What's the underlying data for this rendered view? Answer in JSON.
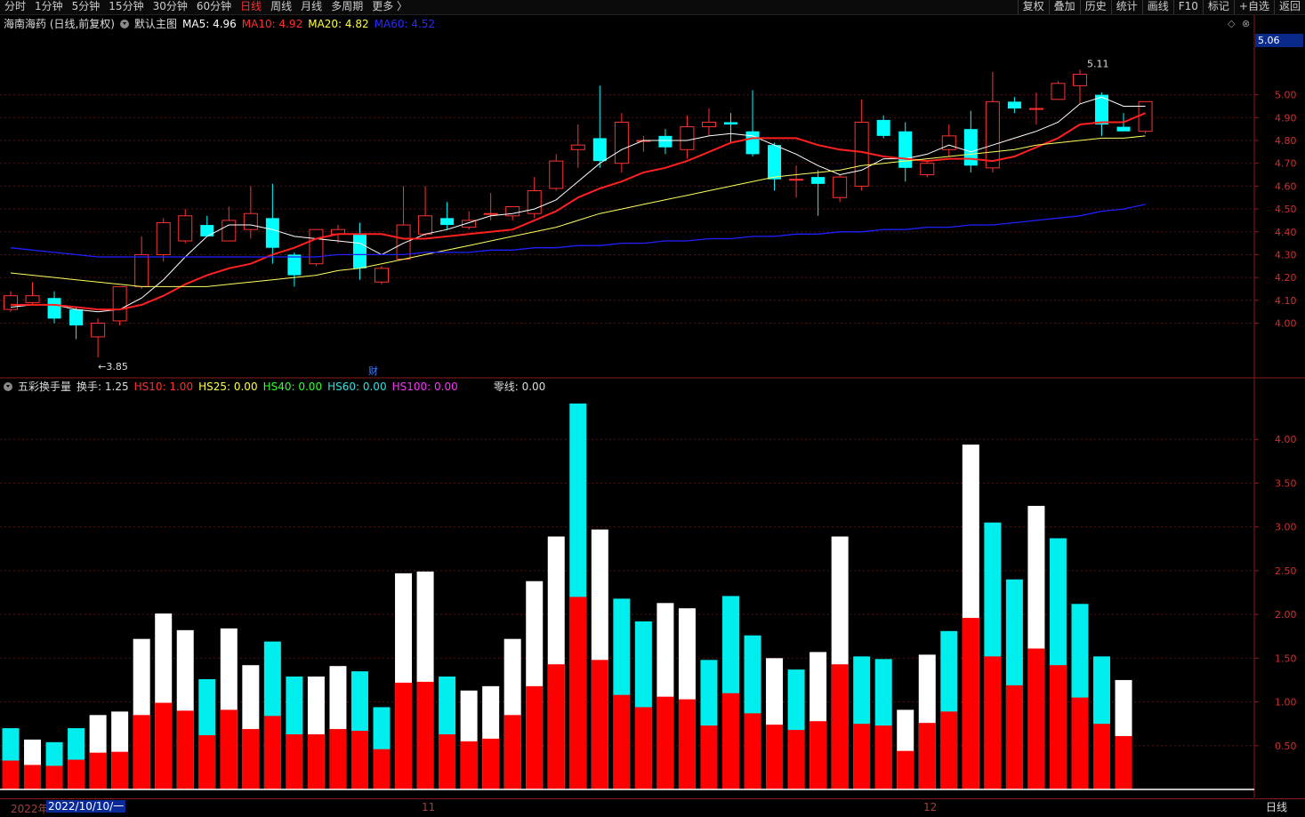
{
  "toolbar": {
    "periods": [
      "分时",
      "1分钟",
      "5分钟",
      "15分钟",
      "30分钟",
      "60分钟",
      "日线",
      "周线",
      "月线",
      "多周期",
      "更多 〉"
    ],
    "active_period": "日线",
    "right_buttons": [
      "复权",
      "叠加",
      "历史",
      "统计",
      "画线",
      "F10",
      "标记",
      "+自选",
      "返回"
    ]
  },
  "main_legend": {
    "stock": "海南海药 (日线,前复权)",
    "template": "默认主图",
    "ma5": "MA5: 4.96",
    "ma10": "MA10: 4.92",
    "ma20": "MA20: 4.82",
    "ma60": "MA60: 4.52"
  },
  "sub_legend": {
    "name": "五彩换手量",
    "turnover": "换手: 1.25",
    "hs10": "HS10: 1.00",
    "hs25": "HS25: 0.00",
    "hs40": "HS40: 0.00",
    "hs60": "HS60: 0.00",
    "hs100": "HS100: 0.00",
    "zero": "零线: 0.00"
  },
  "controls": {
    "diamond": "◇",
    "close": "⊗"
  },
  "current_price": "5.06",
  "fin_marker": "财",
  "bottom": {
    "year": "2022年",
    "cursor_date": "2022/10/10/一",
    "months": [
      "11",
      "12"
    ]
  },
  "period_label": "日线",
  "colors": {
    "up": "#ff3232",
    "down": "#00ffff",
    "ma5": "#ffffff",
    "ma10": "#ff2020",
    "ma20": "#ffff60",
    "ma60": "#2020ff",
    "vol_white": "#ffffff",
    "vol_red": "#ff0000",
    "vol_cyan": "#00eeee"
  },
  "chart_data": [
    {
      "type": "candlestick",
      "title": "海南海药 (日线,前复权)",
      "y_ticks": [
        4.0,
        4.1,
        4.2,
        4.3,
        4.4,
        4.5,
        4.6,
        4.7,
        4.8,
        4.9,
        5.0
      ],
      "ylim": [
        3.78,
        5.24
      ],
      "annotations": [
        {
          "text": "←3.85",
          "value": 3.85
        },
        {
          "text": "5.11",
          "value": 5.11
        }
      ],
      "candles": [
        {
          "o": 4.06,
          "h": 4.14,
          "l": 4.05,
          "c": 4.12
        },
        {
          "o": 4.09,
          "h": 4.18,
          "l": 4.08,
          "c": 4.12
        },
        {
          "o": 4.11,
          "h": 4.14,
          "l": 4.0,
          "c": 4.02
        },
        {
          "o": 4.06,
          "h": 4.07,
          "l": 3.93,
          "c": 3.99
        },
        {
          "o": 3.94,
          "h": 4.02,
          "l": 3.85,
          "c": 4.0
        },
        {
          "o": 4.01,
          "h": 4.16,
          "l": 3.99,
          "c": 4.16
        },
        {
          "o": 4.16,
          "h": 4.38,
          "l": 4.15,
          "c": 4.3
        },
        {
          "o": 4.3,
          "h": 4.46,
          "l": 4.27,
          "c": 4.44
        },
        {
          "o": 4.36,
          "h": 4.5,
          "l": 4.35,
          "c": 4.47
        },
        {
          "o": 4.43,
          "h": 4.47,
          "l": 4.38,
          "c": 4.38
        },
        {
          "o": 4.36,
          "h": 4.51,
          "l": 4.36,
          "c": 4.45
        },
        {
          "o": 4.41,
          "h": 4.6,
          "l": 4.37,
          "c": 4.48
        },
        {
          "o": 4.46,
          "h": 4.61,
          "l": 4.26,
          "c": 4.33
        },
        {
          "o": 4.3,
          "h": 4.31,
          "l": 4.16,
          "c": 4.21
        },
        {
          "o": 4.26,
          "h": 4.41,
          "l": 4.25,
          "c": 4.41
        },
        {
          "o": 4.39,
          "h": 4.43,
          "l": 4.35,
          "c": 4.41
        },
        {
          "o": 4.39,
          "h": 4.44,
          "l": 4.19,
          "c": 4.24
        },
        {
          "o": 4.18,
          "h": 4.25,
          "l": 4.17,
          "c": 4.24
        },
        {
          "o": 4.28,
          "h": 4.6,
          "l": 4.28,
          "c": 4.43
        },
        {
          "o": 4.39,
          "h": 4.6,
          "l": 4.38,
          "c": 4.47
        },
        {
          "o": 4.46,
          "h": 4.53,
          "l": 4.41,
          "c": 4.43
        },
        {
          "o": 4.42,
          "h": 4.49,
          "l": 4.41,
          "c": 4.45
        },
        {
          "o": 4.48,
          "h": 4.57,
          "l": 4.45,
          "c": 4.48
        },
        {
          "o": 4.47,
          "h": 4.51,
          "l": 4.45,
          "c": 4.51
        },
        {
          "o": 4.48,
          "h": 4.64,
          "l": 4.46,
          "c": 4.58
        },
        {
          "o": 4.59,
          "h": 4.74,
          "l": 4.58,
          "c": 4.71
        },
        {
          "o": 4.76,
          "h": 4.87,
          "l": 4.68,
          "c": 4.78
        },
        {
          "o": 4.81,
          "h": 5.04,
          "l": 4.68,
          "c": 4.71
        },
        {
          "o": 4.7,
          "h": 4.92,
          "l": 4.66,
          "c": 4.88
        },
        {
          "o": 4.8,
          "h": 4.82,
          "l": 4.75,
          "c": 4.8
        },
        {
          "o": 4.82,
          "h": 4.85,
          "l": 4.74,
          "c": 4.77
        },
        {
          "o": 4.76,
          "h": 4.91,
          "l": 4.72,
          "c": 4.86
        },
        {
          "o": 4.86,
          "h": 4.94,
          "l": 4.82,
          "c": 4.88
        },
        {
          "o": 4.88,
          "h": 4.92,
          "l": 4.79,
          "c": 4.87
        },
        {
          "o": 4.84,
          "h": 5.02,
          "l": 4.73,
          "c": 4.74
        },
        {
          "o": 4.78,
          "h": 4.79,
          "l": 4.58,
          "c": 4.63
        },
        {
          "o": 4.63,
          "h": 4.69,
          "l": 4.55,
          "c": 4.63
        },
        {
          "o": 4.64,
          "h": 4.67,
          "l": 4.47,
          "c": 4.61
        },
        {
          "o": 4.55,
          "h": 4.65,
          "l": 4.53,
          "c": 4.64
        },
        {
          "o": 4.6,
          "h": 4.98,
          "l": 4.58,
          "c": 4.88
        },
        {
          "o": 4.89,
          "h": 4.91,
          "l": 4.81,
          "c": 4.82
        },
        {
          "o": 4.84,
          "h": 4.88,
          "l": 4.62,
          "c": 4.68
        },
        {
          "o": 4.65,
          "h": 4.71,
          "l": 4.64,
          "c": 4.7
        },
        {
          "o": 4.76,
          "h": 4.87,
          "l": 4.73,
          "c": 4.82
        },
        {
          "o": 4.85,
          "h": 4.93,
          "l": 4.66,
          "c": 4.69
        },
        {
          "o": 4.68,
          "h": 5.1,
          "l": 4.66,
          "c": 4.97
        },
        {
          "o": 4.97,
          "h": 4.99,
          "l": 4.92,
          "c": 4.94
        },
        {
          "o": 4.94,
          "h": 5.01,
          "l": 4.87,
          "c": 4.94
        },
        {
          "o": 4.98,
          "h": 5.06,
          "l": 4.98,
          "c": 5.05
        },
        {
          "o": 5.04,
          "h": 5.11,
          "l": 4.96,
          "c": 5.09
        },
        {
          "o": 5.0,
          "h": 5.01,
          "l": 4.82,
          "c": 4.87
        },
        {
          "o": 4.86,
          "h": 4.92,
          "l": 4.84,
          "c": 4.84
        },
        {
          "o": 4.84,
          "h": 4.97,
          "l": 4.83,
          "c": 4.97
        }
      ],
      "series": [
        {
          "name": "MA5",
          "values": [
            4.07,
            4.08,
            4.08,
            4.06,
            4.05,
            4.06,
            4.11,
            4.19,
            4.29,
            4.38,
            4.43,
            4.43,
            4.41,
            4.38,
            4.37,
            4.36,
            4.35,
            4.3,
            4.35,
            4.39,
            4.41,
            4.44,
            4.47,
            4.48,
            4.5,
            4.54,
            4.62,
            4.7,
            4.76,
            4.8,
            4.8,
            4.8,
            4.82,
            4.83,
            4.82,
            4.78,
            4.74,
            4.69,
            4.65,
            4.67,
            4.72,
            4.72,
            4.74,
            4.78,
            4.75,
            4.78,
            4.81,
            4.84,
            4.88,
            4.96,
            4.99,
            4.95,
            4.95
          ]
        },
        {
          "name": "MA10",
          "values": [
            4.08,
            4.08,
            4.08,
            4.07,
            4.06,
            4.06,
            4.08,
            4.12,
            4.17,
            4.21,
            4.24,
            4.26,
            4.3,
            4.33,
            4.37,
            4.39,
            4.39,
            4.39,
            4.37,
            4.37,
            4.38,
            4.39,
            4.4,
            4.41,
            4.45,
            4.49,
            4.55,
            4.59,
            4.62,
            4.66,
            4.68,
            4.71,
            4.75,
            4.79,
            4.81,
            4.81,
            4.81,
            4.78,
            4.76,
            4.75,
            4.73,
            4.72,
            4.71,
            4.72,
            4.72,
            4.71,
            4.73,
            4.77,
            4.81,
            4.87,
            4.88,
            4.88,
            4.92
          ]
        },
        {
          "name": "MA20",
          "values": [
            4.22,
            4.21,
            4.2,
            4.19,
            4.18,
            4.17,
            4.16,
            4.16,
            4.16,
            4.16,
            4.17,
            4.18,
            4.19,
            4.2,
            4.21,
            4.23,
            4.24,
            4.26,
            4.28,
            4.3,
            4.32,
            4.34,
            4.36,
            4.38,
            4.4,
            4.42,
            4.45,
            4.48,
            4.5,
            4.52,
            4.54,
            4.56,
            4.58,
            4.6,
            4.62,
            4.64,
            4.65,
            4.66,
            4.67,
            4.69,
            4.7,
            4.71,
            4.72,
            4.73,
            4.74,
            4.75,
            4.76,
            4.78,
            4.79,
            4.8,
            4.81,
            4.81,
            4.82
          ]
        },
        {
          "name": "MA60",
          "values": [
            4.33,
            4.32,
            4.31,
            4.3,
            4.29,
            4.29,
            4.29,
            4.29,
            4.29,
            4.29,
            4.29,
            4.29,
            4.29,
            4.29,
            4.29,
            4.3,
            4.3,
            4.3,
            4.3,
            4.31,
            4.31,
            4.31,
            4.32,
            4.32,
            4.33,
            4.33,
            4.34,
            4.34,
            4.35,
            4.35,
            4.36,
            4.36,
            4.37,
            4.37,
            4.38,
            4.38,
            4.39,
            4.39,
            4.4,
            4.4,
            4.41,
            4.41,
            4.42,
            4.42,
            4.43,
            4.43,
            4.44,
            4.45,
            4.46,
            4.47,
            4.49,
            4.5,
            4.52
          ]
        }
      ]
    },
    {
      "type": "bar",
      "title": "五彩换手量",
      "y_ticks": [
        0.5,
        1.0,
        1.5,
        2.0,
        2.5,
        3.0,
        3.5,
        4.0
      ],
      "ylim": [
        0,
        4.5
      ],
      "series": [
        {
          "name": "换手",
          "values": [
            0.7,
            0.57,
            0.54,
            0.7,
            0.85,
            0.89,
            1.72,
            2.01,
            1.82,
            1.26,
            1.84,
            1.42,
            1.69,
            1.29,
            1.29,
            1.41,
            1.35,
            0.94,
            2.47,
            2.49,
            1.29,
            1.13,
            1.18,
            1.72,
            2.38,
            2.89,
            4.41,
            2.97,
            2.18,
            1.92,
            2.13,
            2.07,
            1.48,
            2.21,
            1.76,
            1.5,
            1.37,
            1.57,
            2.89,
            1.52,
            1.49,
            0.91,
            1.54,
            1.81,
            3.94,
            3.05,
            2.4,
            3.24,
            2.87,
            2.12,
            1.52,
            1.25
          ]
        },
        {
          "name": "HS10",
          "values": [
            0.33,
            0.28,
            0.27,
            0.34,
            0.42,
            0.43,
            0.85,
            0.99,
            0.9,
            0.62,
            0.91,
            0.69,
            0.84,
            0.63,
            0.63,
            0.69,
            0.67,
            0.46,
            1.22,
            1.23,
            0.63,
            0.55,
            0.58,
            0.85,
            1.18,
            1.43,
            2.2,
            1.48,
            1.08,
            0.94,
            1.06,
            1.03,
            0.73,
            1.1,
            0.87,
            0.74,
            0.68,
            0.78,
            1.43,
            0.75,
            0.73,
            0.44,
            0.76,
            0.89,
            1.96,
            1.52,
            1.19,
            1.61,
            1.42,
            1.05,
            0.75,
            0.61
          ]
        }
      ],
      "bar_colors": [
        "cyan",
        "white",
        "cyan",
        "cyan",
        "white",
        "white",
        "white",
        "white",
        "white",
        "cyan",
        "white",
        "white",
        "cyan",
        "cyan",
        "white",
        "white",
        "cyan",
        "cyan",
        "white",
        "white",
        "cyan",
        "white",
        "white",
        "white",
        "white",
        "white",
        "cyan",
        "white",
        "cyan",
        "cyan",
        "white",
        "white",
        "cyan",
        "cyan",
        "cyan",
        "white",
        "cyan",
        "white",
        "white",
        "cyan",
        "cyan",
        "white",
        "white",
        "cyan",
        "white",
        "cyan",
        "cyan",
        "white",
        "cyan",
        "cyan",
        "cyan",
        "white"
      ]
    }
  ]
}
